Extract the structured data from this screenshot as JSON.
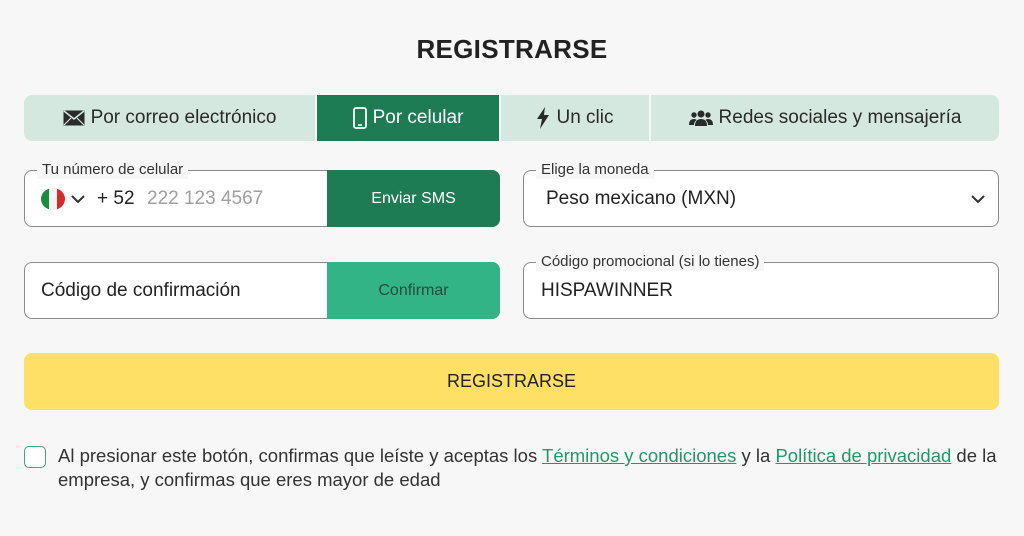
{
  "title": "REGISTRARSE",
  "tabs": [
    {
      "label": "Por correo electrónico",
      "icon": "envelope-icon"
    },
    {
      "label": "Por celular",
      "icon": "mobile-phone-icon"
    },
    {
      "label": "Un clic",
      "icon": "lightning-bolt-icon"
    },
    {
      "label": "Redes sociales y mensajería",
      "icon": "users-icon"
    }
  ],
  "active_tab": "Por celular",
  "phone": {
    "legend": "Tu número de celular",
    "country_flag": "mexico-flag-icon",
    "prefix": "+ 52",
    "placeholder": "222 123 4567",
    "value": "",
    "send_sms_label": "Enviar SMS"
  },
  "currency": {
    "legend": "Elige la moneda",
    "selected": "Peso mexicano (MXN)"
  },
  "confirmation": {
    "placeholder": "Código de confirmación",
    "confirm_label": "Confirmar"
  },
  "promo": {
    "legend": "Código promocional (si lo tienes)",
    "value": "HISPAWINNER"
  },
  "register_label": "REGISTRARSE",
  "terms": {
    "text_before": "Al presionar este botón, confirmas que leíste y aceptas los ",
    "link_terms": "Términos y condiciones",
    "text_middle": " y la ",
    "link_privacy": "Política de privacidad",
    "text_after": " de la empresa, y confirmas que eres mayor de edad",
    "checked": false
  },
  "colors": {
    "accent_green": "#1e7c55",
    "light_green": "#33b487",
    "tab_bg": "#d4e8e0",
    "register_yellow": "#ffe066",
    "link_green": "#1e9a6a"
  }
}
